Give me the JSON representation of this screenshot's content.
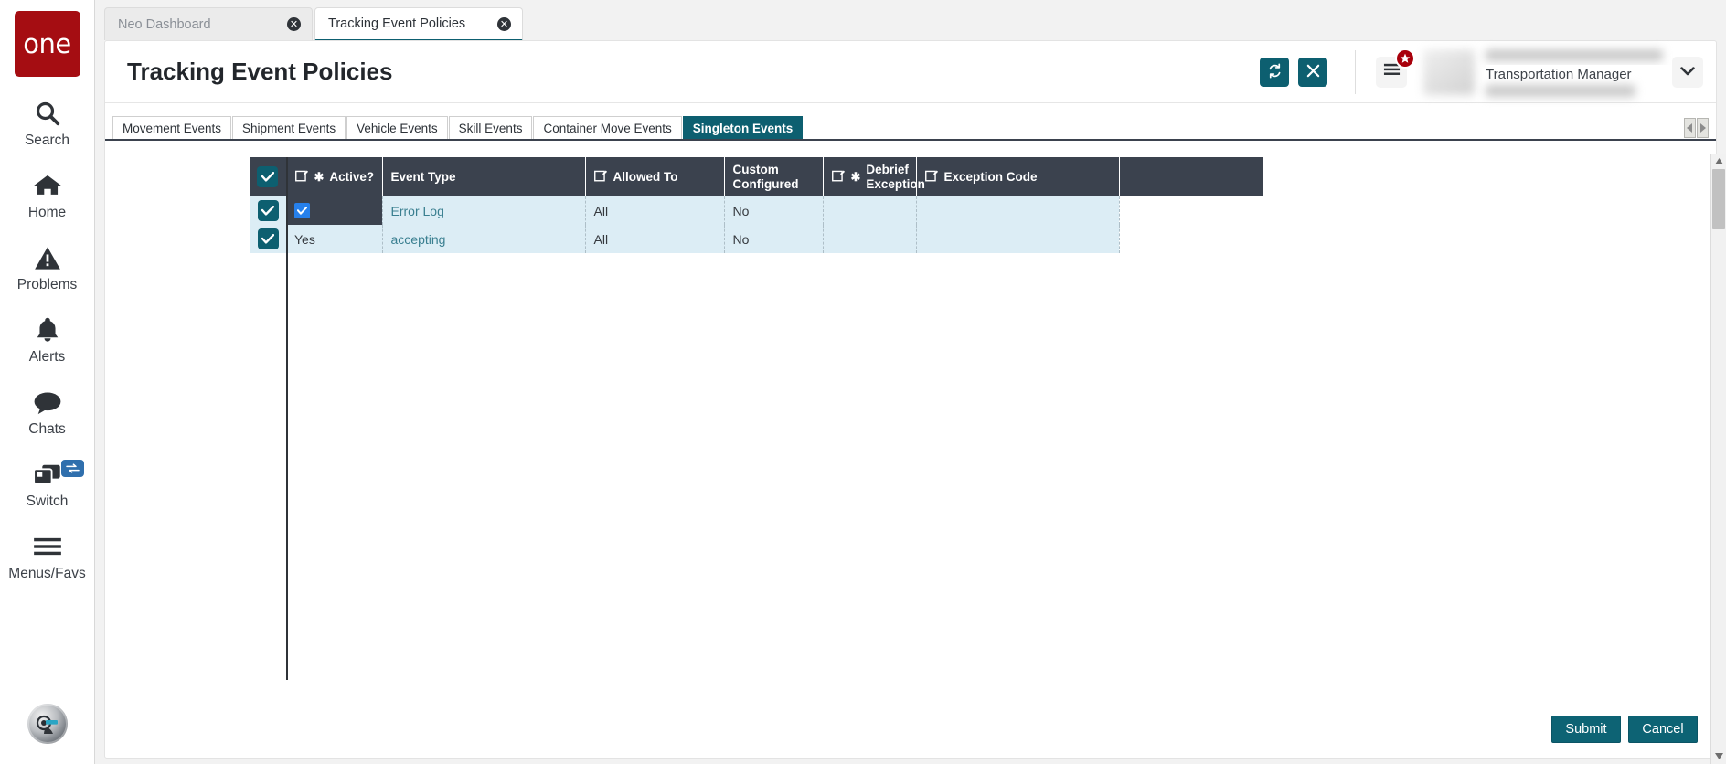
{
  "brand": {
    "logo_text": "one",
    "logo_color": "#a50d12"
  },
  "sidebar": {
    "items": [
      {
        "label": "Search",
        "icon": "search-icon"
      },
      {
        "label": "Home",
        "icon": "home-icon"
      },
      {
        "label": "Problems",
        "icon": "warning-triangle-icon"
      },
      {
        "label": "Alerts",
        "icon": "bell-icon"
      },
      {
        "label": "Chats",
        "icon": "chat-bubble-icon"
      },
      {
        "label": "Switch",
        "icon": "windows-stack-icon",
        "badge_icon": "swap-arrows-icon"
      },
      {
        "label": "Menus/Favs",
        "icon": "hamburger-icon"
      }
    ],
    "assistant_avatar": "ai-assistant-avatar"
  },
  "browser_tabs": [
    {
      "label": "Neo Dashboard",
      "active": false,
      "close_icon": "close-circle-icon"
    },
    {
      "label": "Tracking Event Policies",
      "active": true,
      "close_icon": "close-circle-icon"
    }
  ],
  "header": {
    "title": "Tracking Event Policies",
    "refresh_icon": "refresh-icon",
    "close_icon": "close-x-icon",
    "menu_icon": "hamburger-menu-icon",
    "favorites_badge_icon": "star-icon",
    "user_role": "Transportation Manager",
    "caret_icon": "chevron-down-icon"
  },
  "entity_tabs": [
    {
      "label": "Movement Events",
      "selected": false
    },
    {
      "label": "Shipment Events",
      "selected": false
    },
    {
      "label": "Vehicle Events",
      "selected": false
    },
    {
      "label": "Skill Events",
      "selected": false
    },
    {
      "label": "Container Move Events",
      "selected": false
    },
    {
      "label": "Singleton Events",
      "selected": true
    }
  ],
  "tab_scroll": {
    "left_icon": "chevron-left-icon",
    "right_icon": "chevron-right-icon"
  },
  "grid": {
    "select_all_checked": true,
    "columns": [
      {
        "label": "Active?",
        "editable": true,
        "required": true
      },
      {
        "label": "Event Type",
        "editable": false,
        "required": false
      },
      {
        "label": "Allowed To",
        "editable": true,
        "required": false
      },
      {
        "label": "Custom Configured",
        "editable": false,
        "required": false
      },
      {
        "label": "Debrief Exception",
        "editable": true,
        "required": true
      },
      {
        "label": "Exception Code",
        "editable": true,
        "required": false
      }
    ],
    "rows": [
      {
        "selected": true,
        "active": "",
        "active_editing": true,
        "active_checked": true,
        "event_type": "Error Log",
        "allowed_to": "All",
        "custom_configured": "No",
        "debrief_exception": "",
        "exception_code": ""
      },
      {
        "selected": true,
        "active": "Yes",
        "active_editing": false,
        "active_checked": false,
        "event_type": "accepting",
        "allowed_to": "All",
        "custom_configured": "No",
        "debrief_exception": "",
        "exception_code": ""
      }
    ]
  },
  "footer": {
    "submit_label": "Submit",
    "cancel_label": "Cancel"
  },
  "scrollbar": {
    "up_icon": "caret-up-icon",
    "down_icon": "caret-down-icon"
  },
  "colors": {
    "teal": "#0d5f70",
    "dark_slate": "#3b424e",
    "row_blue": "#dcedf5",
    "link_blue": "#3a7f90",
    "brand_red": "#a50d12",
    "checkbox_blue": "#2680eb"
  }
}
